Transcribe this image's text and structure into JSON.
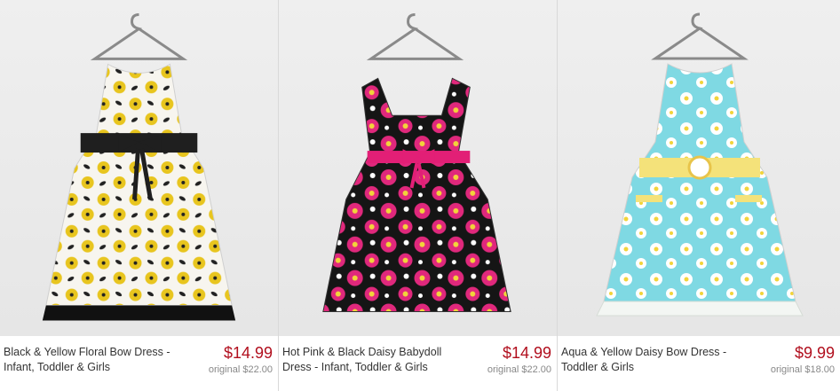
{
  "products": [
    {
      "name": "Black & Yellow Floral Bow Dress - Infant, Toddler & Girls",
      "price": "$14.99",
      "original": "original $22.00",
      "colors": {
        "base": "#f7f5ef",
        "flower": "#e8c51e",
        "accent": "#222222",
        "sash": "#1f1f1f",
        "trim": "#111111"
      }
    },
    {
      "name": "Hot Pink & Black Daisy Babydoll Dress - Infant, Toddler & Girls",
      "price": "$14.99",
      "original": "original $22.00",
      "colors": {
        "base": "#151515",
        "flower": "#e0287c",
        "accent": "#ffffff",
        "sash": "#e21f76",
        "trim": "#111111"
      }
    },
    {
      "name": "Aqua & Yellow Daisy Bow Dress - Toddler & Girls",
      "price": "$9.99",
      "original": "original $18.00",
      "colors": {
        "base": "#7fd9e3",
        "flower": "#ffffff",
        "accent": "#f2d43a",
        "sash": "#f4e27a",
        "trim": "#f3f6f3"
      }
    }
  ]
}
